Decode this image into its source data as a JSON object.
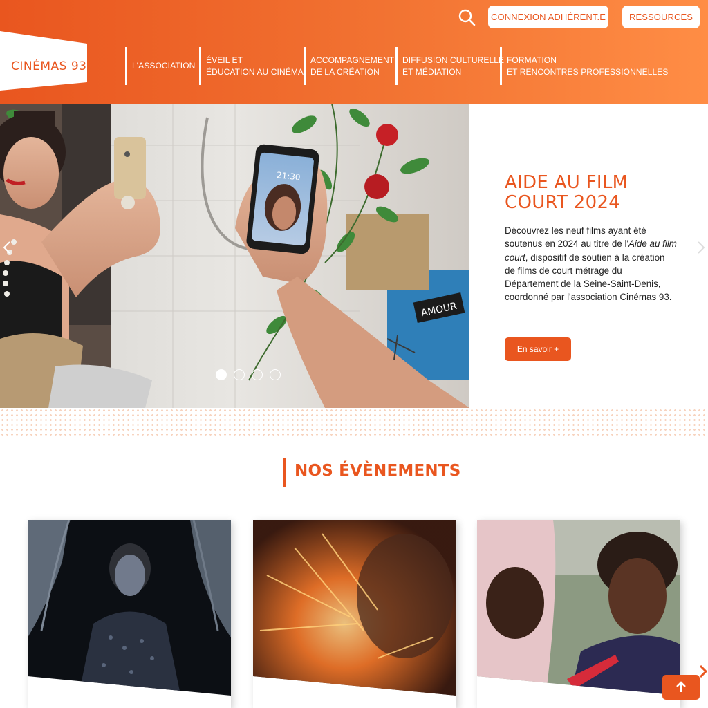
{
  "header": {
    "logo_text": "CINÉMAS 93",
    "search_icon": "search-icon",
    "connexion_label": "CONNEXION ADHÉRENT.E",
    "ressources_label": "RESSOURCES"
  },
  "nav": {
    "items": [
      {
        "lines": [
          "L'ASSOCIATION"
        ]
      },
      {
        "lines": [
          "ÉVEIL ET",
          "ÉDUCATION AU CINÉMA"
        ]
      },
      {
        "lines": [
          "ACCOMPAGNEMENT",
          "DE LA CRÉATION"
        ]
      },
      {
        "lines": [
          "DIFFUSION CULTURELLE",
          "ET MÉDIATION"
        ]
      },
      {
        "lines": [
          "FORMATION",
          "ET RENCONTRES PROFESSIONNELLES"
        ]
      }
    ]
  },
  "hero": {
    "title_line1": "AIDE AU FILM",
    "title_line2": "COURT 2024",
    "desc_part1": "Découvrez les neuf films ayant été soutenus en 2024 au titre de l'",
    "desc_italic": "Aide au film court",
    "desc_part2": ", dispositif de soutien à la création de films de court métrage du Département de la Seine-Saint-Denis, coordonné par l'association Cinémas 93.",
    "cta_label": "En savoir +",
    "phone_time": "21:30",
    "sign_text": "AMOUR",
    "active_slide": 1,
    "slide_count": 4
  },
  "events": {
    "title": "NOS ÉVÈNEMENTS"
  },
  "colors": {
    "accent": "#e9561f",
    "header_end": "#ff8d45"
  }
}
